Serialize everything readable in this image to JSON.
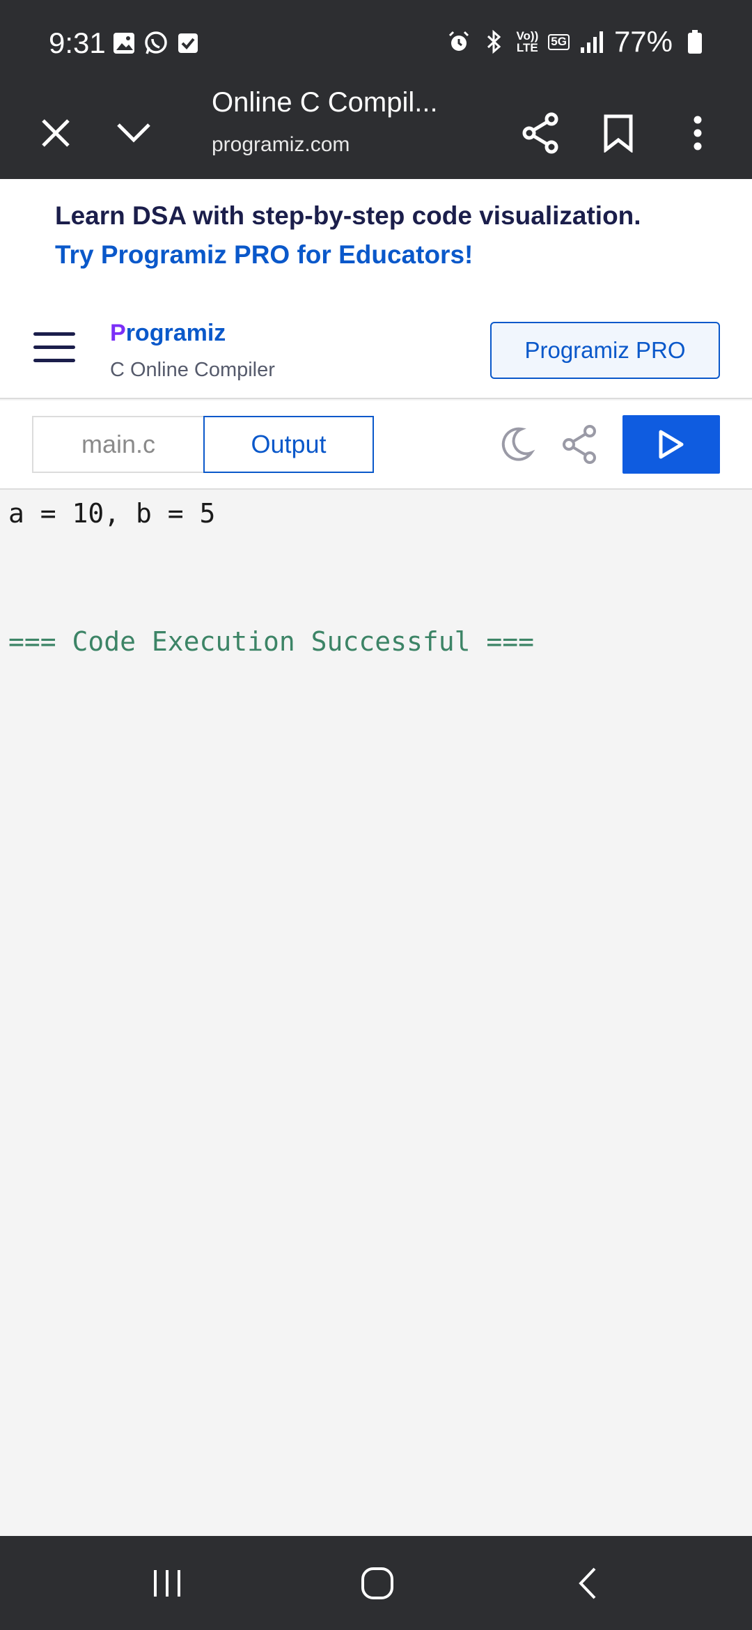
{
  "status_bar": {
    "time": "9:31",
    "battery_percent": "77%",
    "network_tag_top": "Vo))",
    "network_tag_bottom": "LTE",
    "network_5g": "5G",
    "left_icons": [
      "gallery-icon",
      "whatsapp-icon",
      "checkbox-icon"
    ],
    "right_icons": [
      "alarm-icon",
      "bluetooth-icon",
      "signal-icon",
      "battery-icon"
    ]
  },
  "browser": {
    "page_title": "Online C Compil...",
    "url": "programiz.com",
    "icons": [
      "close-icon",
      "chevron-down-icon",
      "share-icon",
      "bookmark-icon",
      "more-icon"
    ]
  },
  "promo": {
    "line1": "Learn DSA with step-by-step code visualization.",
    "line2": "Try Programiz PRO for Educators!"
  },
  "site_header": {
    "logo_text": "rogramiz",
    "logo_mark": "P",
    "subtitle": "C Online Compiler",
    "pro_button": "Programiz PRO"
  },
  "editor_tabs": {
    "file_tab": "main.c",
    "output_tab": "Output",
    "active_tab": "Output"
  },
  "output": {
    "lines": [
      "a = 10, b = 5",
      "=== Code Execution Successful ==="
    ]
  },
  "colors": {
    "brand_blue": "#0a58ca",
    "run_button": "#0f5ce0",
    "success_text": "#3c8466",
    "system_bar": "#2d2e31"
  }
}
